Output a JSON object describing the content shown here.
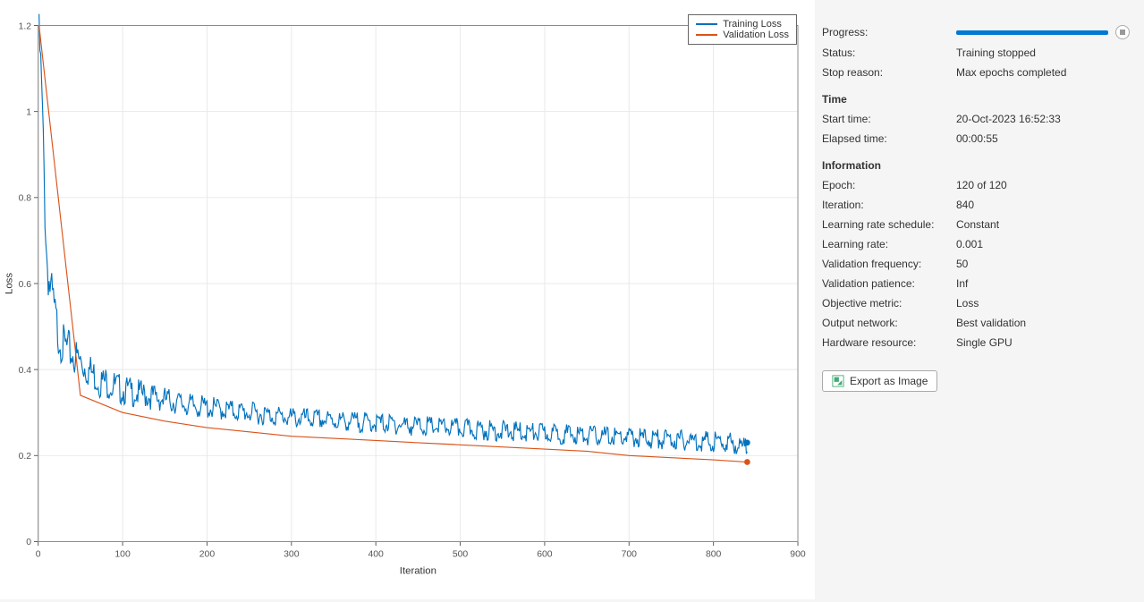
{
  "chart_data": {
    "type": "line",
    "xlabel": "Iteration",
    "ylabel": "Loss",
    "xlim": [
      0,
      900
    ],
    "ylim": [
      0,
      1.2
    ],
    "x_ticks": [
      0,
      100,
      200,
      300,
      400,
      500,
      600,
      700,
      800,
      900
    ],
    "y_ticks": [
      0,
      0.2,
      0.4,
      0.6,
      0.8,
      1,
      1.2
    ],
    "series": [
      {
        "name": "Training Loss",
        "color": "#0072bd",
        "x": [
          1,
          2,
          3,
          4,
          5,
          6,
          7,
          8,
          9,
          10,
          12,
          14,
          16,
          18,
          20,
          22,
          24,
          26,
          28,
          30,
          35,
          40,
          45,
          50,
          55,
          60,
          65,
          70,
          75,
          80,
          90,
          100,
          110,
          120,
          130,
          140,
          150,
          160,
          170,
          180,
          190,
          200,
          220,
          240,
          260,
          280,
          300,
          320,
          340,
          360,
          380,
          400,
          420,
          440,
          460,
          480,
          500,
          520,
          540,
          560,
          580,
          600,
          620,
          640,
          660,
          680,
          700,
          720,
          740,
          760,
          780,
          800,
          820,
          840
        ],
        "values": [
          1.2,
          1.17,
          1.13,
          1.08,
          1.02,
          0.95,
          0.88,
          0.8,
          0.75,
          0.7,
          0.65,
          0.62,
          0.6,
          0.58,
          0.55,
          0.53,
          0.51,
          0.5,
          0.49,
          0.48,
          0.47,
          0.46,
          0.45,
          0.44,
          0.43,
          0.42,
          0.41,
          0.4,
          0.39,
          0.39,
          0.38,
          0.37,
          0.365,
          0.36,
          0.355,
          0.35,
          0.345,
          0.34,
          0.335,
          0.33,
          0.328,
          0.325,
          0.32,
          0.315,
          0.31,
          0.305,
          0.3,
          0.298,
          0.295,
          0.292,
          0.29,
          0.288,
          0.285,
          0.282,
          0.28,
          0.278,
          0.275,
          0.272,
          0.27,
          0.268,
          0.266,
          0.264,
          0.262,
          0.26,
          0.258,
          0.256,
          0.254,
          0.252,
          0.25,
          0.248,
          0.246,
          0.244,
          0.242,
          0.23
        ],
        "end_marker": {
          "x": 840,
          "y": 0.23
        }
      },
      {
        "name": "Validation Loss",
        "color": "#d95319",
        "x": [
          1,
          50,
          100,
          150,
          200,
          250,
          300,
          350,
          400,
          450,
          500,
          550,
          600,
          650,
          700,
          750,
          800,
          840
        ],
        "values": [
          1.2,
          0.34,
          0.3,
          0.28,
          0.265,
          0.255,
          0.245,
          0.24,
          0.235,
          0.23,
          0.225,
          0.22,
          0.215,
          0.21,
          0.2,
          0.195,
          0.19,
          0.185
        ],
        "end_marker": {
          "x": 840,
          "y": 0.185
        }
      }
    ]
  },
  "legend": {
    "items": [
      "Training Loss",
      "Validation Loss"
    ]
  },
  "panel": {
    "progress_label": "Progress:",
    "progress_percent": 100,
    "status_label": "Status:",
    "status_value": "Training stopped",
    "stop_reason_label": "Stop reason:",
    "stop_reason_value": "Max epochs completed",
    "time_header": "Time",
    "start_time_label": "Start time:",
    "start_time_value": "20-Oct-2023 16:52:33",
    "elapsed_label": "Elapsed time:",
    "elapsed_value": "00:00:55",
    "info_header": "Information",
    "epoch_label": "Epoch:",
    "epoch_value": "120 of 120",
    "iteration_label": "Iteration:",
    "iteration_value": "840",
    "lr_schedule_label": "Learning rate schedule:",
    "lr_schedule_value": "Constant",
    "lr_label": "Learning rate:",
    "lr_value": "0.001",
    "val_freq_label": "Validation frequency:",
    "val_freq_value": "50",
    "val_patience_label": "Validation patience:",
    "val_patience_value": "Inf",
    "obj_metric_label": "Objective metric:",
    "obj_metric_value": "Loss",
    "output_net_label": "Output network:",
    "output_net_value": "Best validation",
    "hardware_label": "Hardware resource:",
    "hardware_value": "Single GPU",
    "export_label": "Export as Image"
  }
}
